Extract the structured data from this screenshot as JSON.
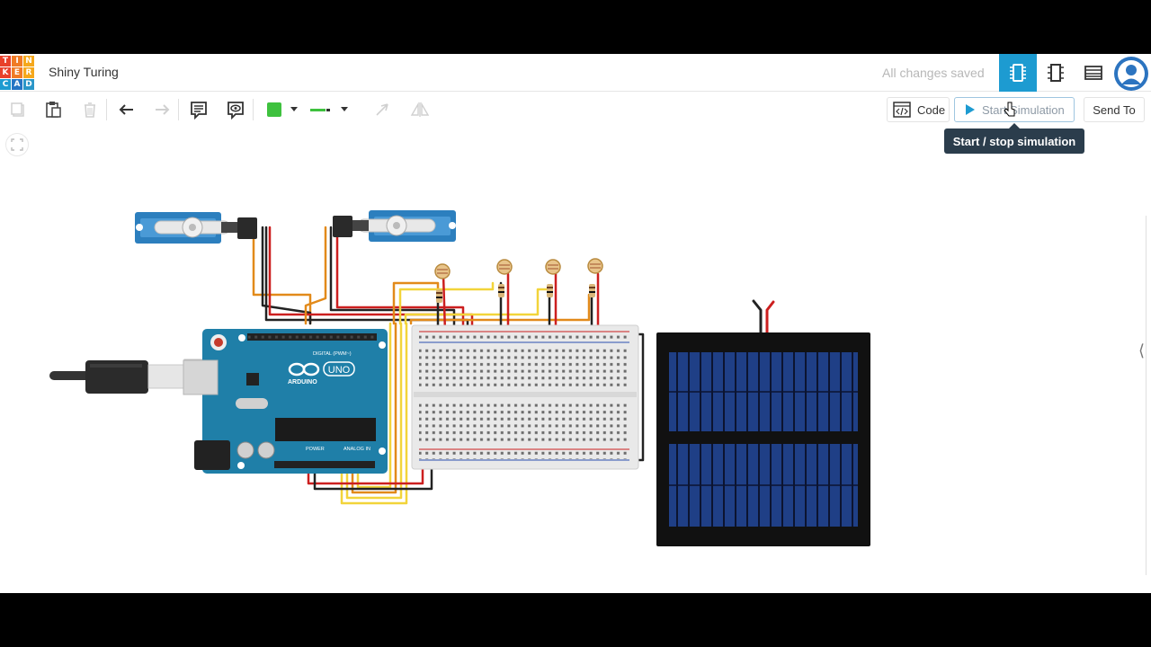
{
  "app": {
    "logo_letters": [
      "T",
      "I",
      "N",
      "K",
      "E",
      "R",
      "C",
      "A",
      "D"
    ],
    "logo_colors": [
      "#e8412b",
      "#f07b25",
      "#f5a81c",
      "#e8412b",
      "#f07b25",
      "#f5a81c",
      "#1d9bd1",
      "#2575c4",
      "#2a96c8"
    ],
    "project_title": "Shiny Turing",
    "save_status": "All changes saved"
  },
  "toolbar": {
    "code_label": "Code",
    "sim_label": "Start Simulation",
    "sendto_label": "Send To",
    "tooltip": "Start / stop simulation",
    "fill_color": "#3ec13e",
    "wire_color": "#3ec13e"
  },
  "colors": {
    "accent": "#1d9bd1",
    "tooltip_bg": "#2b3d4c"
  },
  "circuit": {
    "arduino_text": {
      "brand": "ARDUINO",
      "model": "UNO",
      "digital": "DIGITAL (PWM~)",
      "power": "POWER",
      "analog": "ANALOG IN"
    },
    "components": [
      "servo-left",
      "servo-right",
      "arduino-uno",
      "usb-cable",
      "breadboard",
      "photoresistor-1",
      "photoresistor-2",
      "photoresistor-3",
      "photoresistor-4",
      "resistor-1",
      "resistor-2",
      "resistor-3",
      "resistor-4",
      "solar-panel"
    ]
  }
}
